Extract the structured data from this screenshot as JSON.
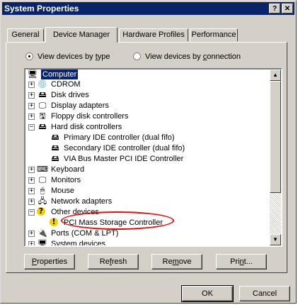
{
  "window": {
    "title": "System Properties",
    "help_glyph": "?",
    "close_glyph": "✕"
  },
  "tabs": [
    {
      "label": "General"
    },
    {
      "label": "Device Manager",
      "active": true
    },
    {
      "label": "Hardware Profiles"
    },
    {
      "label": "Performance"
    }
  ],
  "view_options": {
    "by_type": {
      "pre": "View devices by ",
      "acc": "t",
      "post": "ype",
      "selected": true
    },
    "by_connection": {
      "pre": "View devices by ",
      "acc": "c",
      "post": "onnection",
      "selected": false
    }
  },
  "tree": {
    "items": [
      {
        "label": "Computer",
        "icon": "computer-icon",
        "glyph": "🖥",
        "expander": "",
        "selected": true
      },
      {
        "label": "CDROM",
        "icon": "cdrom-icon",
        "glyph": "💿",
        "expander": "+"
      },
      {
        "label": "Disk drives",
        "icon": "disk-drive-icon",
        "glyph": "🖴",
        "expander": "+"
      },
      {
        "label": "Display adapters",
        "icon": "display-adapter-icon",
        "glyph": "🖵",
        "expander": "+"
      },
      {
        "label": "Floppy disk controllers",
        "icon": "floppy-controller-icon",
        "glyph": "🖫",
        "expander": "+"
      },
      {
        "label": "Hard disk controllers",
        "icon": "hard-disk-controller-icon",
        "glyph": "🖴",
        "expander": "−"
      },
      {
        "label": "Primary IDE controller (dual fifo)",
        "icon": "ide-controller-icon",
        "glyph": "🖴",
        "expander": ""
      },
      {
        "label": "Secondary IDE controller (dual fifo)",
        "icon": "ide-controller-icon",
        "glyph": "🖴",
        "expander": ""
      },
      {
        "label": "VIA Bus Master PCI IDE Controller",
        "icon": "ide-controller-icon",
        "glyph": "🖴",
        "expander": ""
      },
      {
        "label": "Keyboard",
        "icon": "keyboard-icon",
        "glyph": "⌨",
        "expander": "+"
      },
      {
        "label": "Monitors",
        "icon": "monitor-icon",
        "glyph": "🖵",
        "expander": "+"
      },
      {
        "label": "Mouse",
        "icon": "mouse-icon",
        "glyph": "🖱",
        "expander": "+"
      },
      {
        "label": "Network adapters",
        "icon": "network-adapter-icon",
        "glyph": "🖧",
        "expander": "+"
      },
      {
        "label": "Other devices",
        "icon": "unknown-device-icon",
        "glyph": "?",
        "expander": "−"
      },
      {
        "label": "PCI Mass Storage Controller",
        "icon": "warning-device-icon",
        "glyph": "!",
        "expander": ""
      },
      {
        "label": "Ports (COM & LPT)",
        "icon": "port-icon",
        "glyph": "🔌",
        "expander": "+"
      },
      {
        "label": "System devices",
        "icon": "system-devices-icon",
        "glyph": "🖥",
        "expander": "+"
      }
    ]
  },
  "action_buttons": {
    "properties": {
      "acc": "P",
      "rest": "roperties"
    },
    "refresh": {
      "pre": "Re",
      "acc": "f",
      "post": "resh"
    },
    "remove": {
      "pre": "Re",
      "acc": "m",
      "post": "ove"
    },
    "print": {
      "pre": "Pri",
      "acc": "n",
      "post": "t..."
    }
  },
  "dialog_buttons": {
    "ok": "OK",
    "cancel": "Cancel"
  },
  "colors": {
    "titlebar": "#0a246a",
    "face": "#d4d0c8",
    "selection": "#0a246a",
    "annotation": "#e01010"
  }
}
